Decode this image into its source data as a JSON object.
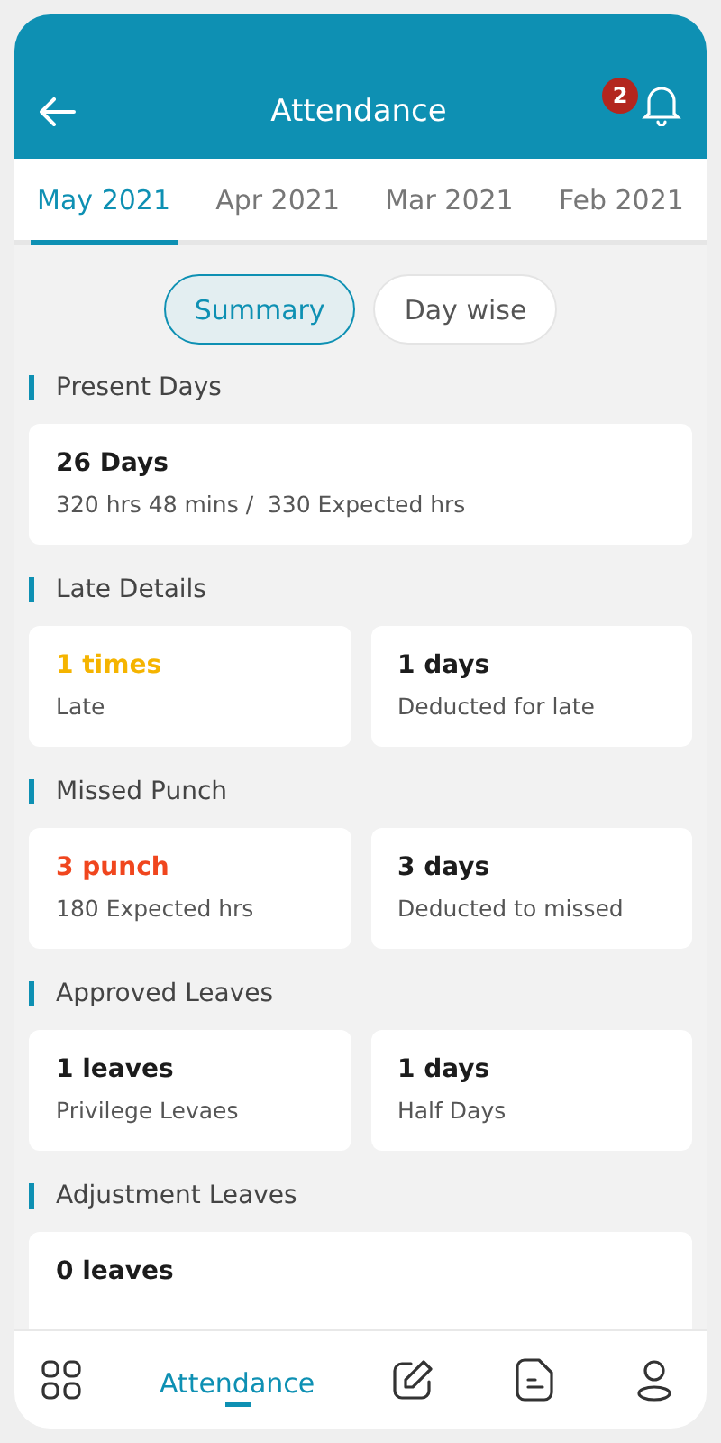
{
  "header": {
    "title": "Attendance",
    "notification_count": "2"
  },
  "tabs": [
    {
      "label": "May 2021",
      "selected": true
    },
    {
      "label": "Apr 2021",
      "selected": false
    },
    {
      "label": "Mar 2021",
      "selected": false
    },
    {
      "label": "Feb 2021",
      "selected": false
    }
  ],
  "view_toggle": [
    {
      "label": "Summary",
      "selected": true
    },
    {
      "label": "Day wise",
      "selected": false
    }
  ],
  "sections": [
    {
      "title": "Present Days",
      "cards": [
        {
          "value": "26 Days",
          "caption": "320 hrs 48 mins /  330 Expected hrs",
          "color": "#1c1c1c"
        }
      ]
    },
    {
      "title": "Late Details",
      "cards": [
        {
          "value": "1 times",
          "caption": "Late",
          "color": "#f5b400"
        },
        {
          "value": "1 days",
          "caption": "Deducted for late",
          "color": "#1c1c1c"
        }
      ]
    },
    {
      "title": "Missed Punch",
      "cards": [
        {
          "value": "3 punch",
          "caption": "180 Expected hrs",
          "color": "#f0461e"
        },
        {
          "value": "3 days",
          "caption": "Deducted to missed",
          "color": "#1c1c1c"
        }
      ]
    },
    {
      "title": "Approved Leaves",
      "cards": [
        {
          "value": "1 leaves",
          "caption": "Privilege Levaes",
          "color": "#1c1c1c"
        },
        {
          "value": "1 days",
          "caption": "Half Days",
          "color": "#1c1c1c"
        }
      ]
    },
    {
      "title": "Adjustment Leaves",
      "cards": [
        {
          "value": "0 leaves",
          "color": "#1c1c1c"
        }
      ]
    }
  ],
  "bottom_nav": [
    {
      "kind": "grid",
      "selected": false
    },
    {
      "kind": "label",
      "label": "Attendance",
      "selected": true
    },
    {
      "kind": "edit",
      "selected": false
    },
    {
      "kind": "document",
      "selected": false
    },
    {
      "kind": "profile",
      "selected": false
    }
  ]
}
